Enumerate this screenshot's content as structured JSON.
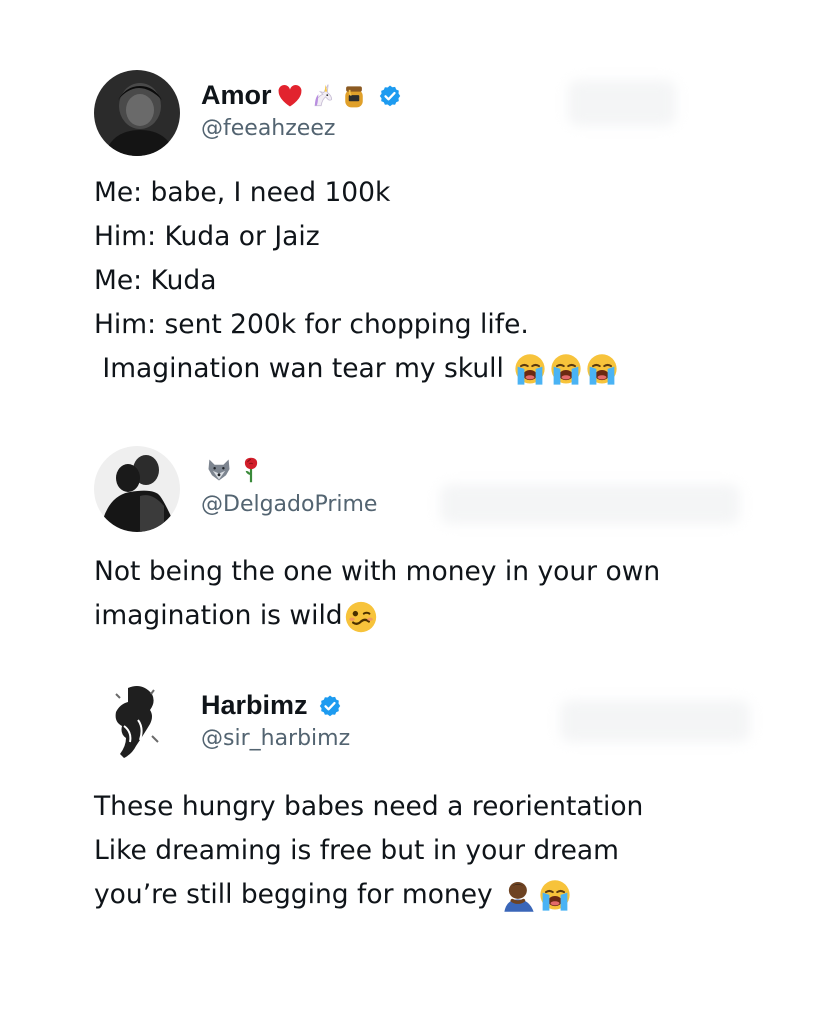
{
  "tweets": [
    {
      "display_name": "Amor",
      "name_emojis": [
        "red-heart",
        "unicorn",
        "honey-pot"
      ],
      "verified": true,
      "handle": "@feeahzeez",
      "lines": [
        "Me: babe, I need 100k",
        "Him: Kuda or Jaiz",
        "Me: Kuda",
        "Him: sent 200k for chopping life.",
        " Imagination wan tear my skull"
      ],
      "trailing_emojis": [
        "loudly-crying-face",
        "loudly-crying-face",
        "loudly-crying-face"
      ]
    },
    {
      "display_name": "",
      "name_emojis": [
        "wolf-face",
        "rose"
      ],
      "verified": false,
      "handle": "@DelgadoPrime",
      "lines": [
        "Not being the one with money in your own",
        "imagination is wild"
      ],
      "trailing_emojis": [
        "woozy-face"
      ]
    },
    {
      "display_name": "Harbimz",
      "name_emojis": [],
      "verified": true,
      "handle": "@sir_harbimz",
      "lines": [
        "These hungry babes need a reorientation",
        "Like dreaming is free but in your dream",
        "you’re still begging for money"
      ],
      "trailing_emojis": [
        "man-bowing",
        "loudly-crying-face"
      ]
    }
  ],
  "colors": {
    "text": "#0f1419",
    "handle": "#536471",
    "verified_blue": "#1d9bf0",
    "background": "#ffffff"
  }
}
